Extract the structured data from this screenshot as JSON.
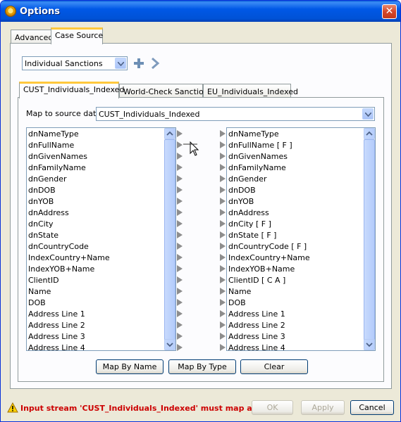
{
  "window": {
    "title": "Options",
    "close_glyph": "✕"
  },
  "outer_tabs": [
    {
      "label": "Advanced",
      "active": false
    },
    {
      "label": "Case Source",
      "active": true
    }
  ],
  "source_select": {
    "value": "Individual Sanctions"
  },
  "toolbar": {
    "add_icon": "plus-icon",
    "next_icon": "chevron-right-icon"
  },
  "inner_tabs": [
    {
      "label": "CUST_Individuals_Indexed",
      "active": true
    },
    {
      "label": "World-Check Sanctions",
      "active": false
    },
    {
      "label": "EU_Individuals_Indexed",
      "active": false
    }
  ],
  "map_to": {
    "label": "Map to source data",
    "value": "CUST_Individuals_Indexed"
  },
  "left_list": [
    "dnNameType",
    "dnFullName",
    "dnGivenNames",
    "dnFamilyName",
    "dnGender",
    "dnDOB",
    "dnYOB",
    "dnAddress",
    "dnCity",
    "dnState",
    "dnCountryCode",
    "IndexCountry+Name",
    "IndexYOB+Name",
    "ClientID",
    "Name",
    "DOB",
    "Address Line 1",
    "Address Line 2",
    "Address Line 3",
    "Address Line 4"
  ],
  "right_list": [
    "dnNameType",
    "dnFullName    [ F ]",
    "dnGivenNames",
    "dnFamilyName",
    "dnGender",
    "dnDOB",
    "dnYOB",
    "dnAddress",
    "dnCity    [ F ]",
    "dnState    [ F ]",
    "dnCountryCode    [ F ]",
    "IndexCountry+Name",
    "IndexYOB+Name",
    "ClientID    [ C A ]",
    "Name",
    "DOB",
    "Address Line 1",
    "Address Line 2",
    "Address Line 3",
    "Address Line 4"
  ],
  "map_buttons": {
    "by_name": "Map By Name",
    "by_type": "Map By Type",
    "clear": "Clear"
  },
  "status": {
    "message": "Input stream 'CUST_Individuals_Indexed' must map at...",
    "icon": "warning-icon"
  },
  "footer_buttons": {
    "ok": "OK",
    "apply": "Apply",
    "cancel": "Cancel"
  },
  "colors": {
    "title_bar": "#0054e3",
    "error_text": "#cc0000",
    "active_tab_accent": "#ffc83c"
  }
}
